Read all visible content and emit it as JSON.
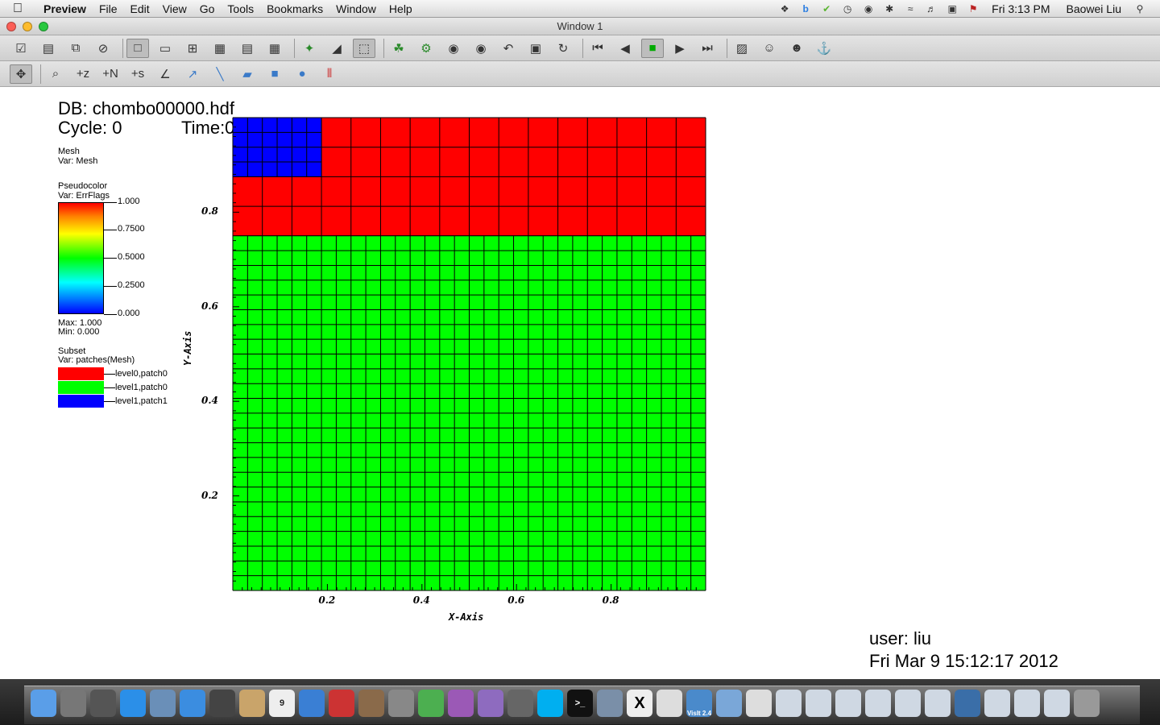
{
  "menubar": {
    "app_name": "Preview",
    "menus": [
      "File",
      "Edit",
      "View",
      "Go",
      "Tools",
      "Bookmarks",
      "Window",
      "Help"
    ],
    "status_icons": [
      "dropbox-icon",
      "b-icon",
      "check-icon",
      "time-machine-icon",
      "binoculars-icon",
      "bluetooth-icon",
      "wifi-icon",
      "volume-icon",
      "battery-icon",
      "flag-icon"
    ],
    "clock": "Fri 3:13 PM",
    "user": "Baowei Liu"
  },
  "window": {
    "title": "Window 1"
  },
  "toolbar1": [
    "clear-icon",
    "new-window-icon",
    "copy-icon",
    "close-icon",
    "layout-1x1-icon",
    "layout-1x2-icon",
    "layout-2x2-icon",
    "layout-2x3-icon",
    "layout-2x4-icon",
    "layout-3x3-icon",
    "pick-icon",
    "lineout-icon",
    "3d-icon",
    "plot-icon",
    "operator-icon",
    "camera-icon",
    "camera2-icon",
    "undo-icon",
    "save-icon",
    "sync-icon",
    "first-frame-icon",
    "prev-frame-icon",
    "stop-icon",
    "play-icon",
    "last-frame-icon",
    "palette-icon",
    "person-icon",
    "person2-icon",
    "lock-icon"
  ],
  "toolbar2": [
    "navigate-icon",
    "zoom-icon",
    "pick-z-icon",
    "pick-n-icon",
    "pick-s-icon",
    "axes-icon",
    "lineout-tool-icon",
    "line-icon",
    "plane-icon",
    "box-icon",
    "sphere-icon",
    "axis-array-icon"
  ],
  "annotation": {
    "db": "DB: chombo00000.hdf",
    "cycle": "Cycle: 0",
    "time": "Time:0",
    "mesh_title": "Mesh",
    "mesh_var": "Var: Mesh",
    "pc_title": "Pseudocolor",
    "pc_var": "Var: ErrFlags",
    "pc_ticks": [
      "1.000",
      "0.7500",
      "0.5000",
      "0.2500",
      "0.000"
    ],
    "pc_max": "Max:  1.000",
    "pc_min": "Min:  0.000",
    "subset_title": "Subset",
    "subset_var": "Var: patches(Mesh)",
    "subsets": [
      {
        "label": "level0,patch0",
        "color": "#ff0000"
      },
      {
        "label": "level1,patch0",
        "color": "#00ff00"
      },
      {
        "label": "level1,patch1",
        "color": "#0000ff"
      }
    ],
    "user": "user: liu",
    "date": "Fri Mar  9 15:12:17 2012"
  },
  "chart_data": {
    "type": "heatmap",
    "xlabel": "X-Axis",
    "ylabel": "Y-Axis",
    "xlim": [
      0,
      1
    ],
    "ylim": [
      0,
      1
    ],
    "x_ticks": [
      "0.2",
      "0.4",
      "0.6",
      "0.8"
    ],
    "y_ticks": [
      "0.2",
      "0.4",
      "0.6",
      "0.8"
    ],
    "x_tick_values": [
      0.2,
      0.4,
      0.6,
      0.8
    ],
    "y_tick_values": [
      0.2,
      0.4,
      0.6,
      0.8
    ],
    "regions": [
      {
        "name": "level0,patch0",
        "x": [
          0,
          1
        ],
        "y": [
          0.75,
          1
        ],
        "cells": [
          16,
          4
        ],
        "color": "#ff0000"
      },
      {
        "name": "level1,patch0",
        "x": [
          0,
          1
        ],
        "y": [
          0,
          0.75
        ],
        "cells": [
          32,
          24
        ],
        "color": "#00ff00"
      },
      {
        "name": "level1,patch1",
        "x": [
          0,
          0.1875
        ],
        "y": [
          0.875,
          1
        ],
        "cells": [
          6,
          4
        ],
        "color": "#0000ff"
      }
    ]
  },
  "dock": {
    "items": [
      {
        "name": "finder-icon",
        "color": "#5a9ee8"
      },
      {
        "name": "launchpad-icon",
        "color": "#777"
      },
      {
        "name": "dashboard-icon",
        "color": "#555"
      },
      {
        "name": "app-store-icon",
        "color": "#2b8fe8"
      },
      {
        "name": "preview-app-icon",
        "color": "#6a8fb8"
      },
      {
        "name": "safari-icon",
        "color": "#3b8de0"
      },
      {
        "name": "facetime-icon",
        "color": "#444"
      },
      {
        "name": "contacts-icon",
        "color": "#c9a46a"
      },
      {
        "name": "calendar-icon",
        "color": "#eee"
      },
      {
        "name": "itunes-icon",
        "color": "#3a7fd4"
      },
      {
        "name": "photo-booth-icon",
        "color": "#c33"
      },
      {
        "name": "iphoto-icon",
        "color": "#8a6a4a"
      },
      {
        "name": "system-preferences-icon",
        "color": "#888"
      },
      {
        "name": "chrome-icon",
        "color": "#4caf50"
      },
      {
        "name": "emacs-icon",
        "color": "#9b59b6"
      },
      {
        "name": "word-icon",
        "color": "#8e6bbf"
      },
      {
        "name": "utilities-icon",
        "color": "#666"
      },
      {
        "name": "skype-icon",
        "color": "#00aff0"
      },
      {
        "name": "terminal-icon",
        "color": "#111"
      },
      {
        "name": "mail-icon",
        "color": "#7a8fa8"
      },
      {
        "name": "x11-icon",
        "color": "#eee"
      },
      {
        "name": "script-icon",
        "color": "#ddd"
      },
      {
        "name": "visit-icon",
        "color": "#4a8acb"
      },
      {
        "name": "folder-icon",
        "color": "#7aa7d8"
      },
      {
        "name": "document-icon",
        "color": "#ddd"
      },
      {
        "name": "window-thumb-1-icon",
        "color": "#cfd8e3"
      },
      {
        "name": "window-thumb-2-icon",
        "color": "#cfd8e3"
      },
      {
        "name": "window-thumb-3-icon",
        "color": "#cfd8e3"
      },
      {
        "name": "window-thumb-4-icon",
        "color": "#cfd8e3"
      },
      {
        "name": "window-thumb-5-icon",
        "color": "#cfd8e3"
      },
      {
        "name": "window-thumb-6-icon",
        "color": "#cfd8e3"
      },
      {
        "name": "window-thumb-7-icon",
        "color": "#3a6ea8"
      },
      {
        "name": "window-thumb-8-icon",
        "color": "#cfd8e3"
      },
      {
        "name": "window-thumb-9-icon",
        "color": "#cfd8e3"
      },
      {
        "name": "window-thumb-10-icon",
        "color": "#cfd8e3"
      },
      {
        "name": "trash-icon",
        "color": "#999"
      }
    ],
    "calendar_day": "9",
    "x11_label": "X",
    "visit_label": "VisIt 2.4"
  }
}
